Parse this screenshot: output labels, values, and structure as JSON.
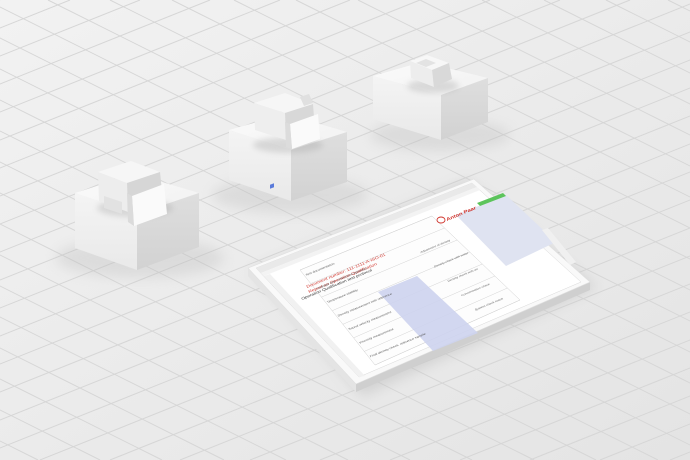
{
  "tablet": {
    "document_number": "Document number: 111-1111-A-ISO-01",
    "report_title": "Report on Operation Qualification",
    "section_title": "Operation Qualification test protocol",
    "brand_name": "Anton Paar",
    "table_rows": [
      "Test documentation",
      "Leakage test: instrument tightness",
      "Temperature stability",
      "Density measurement with reference",
      "Sound velocity measurement",
      "Viscosity measurement",
      "Final density check, reference sample"
    ],
    "right_rows": [
      "Adjustment of density",
      "Density check with water",
      "Density check with air",
      "Concentration check",
      "System check result"
    ]
  },
  "colors": {
    "background": "#ececec",
    "accent_red": "#d0342c",
    "progress_green": "#5cc45c",
    "form_field": "#cdd3ee"
  },
  "icons": [
    "anton-paar-logo-icon",
    "toolbar-pen-icon",
    "toolbar-cursor-icon",
    "toolbar-shape-icon"
  ]
}
